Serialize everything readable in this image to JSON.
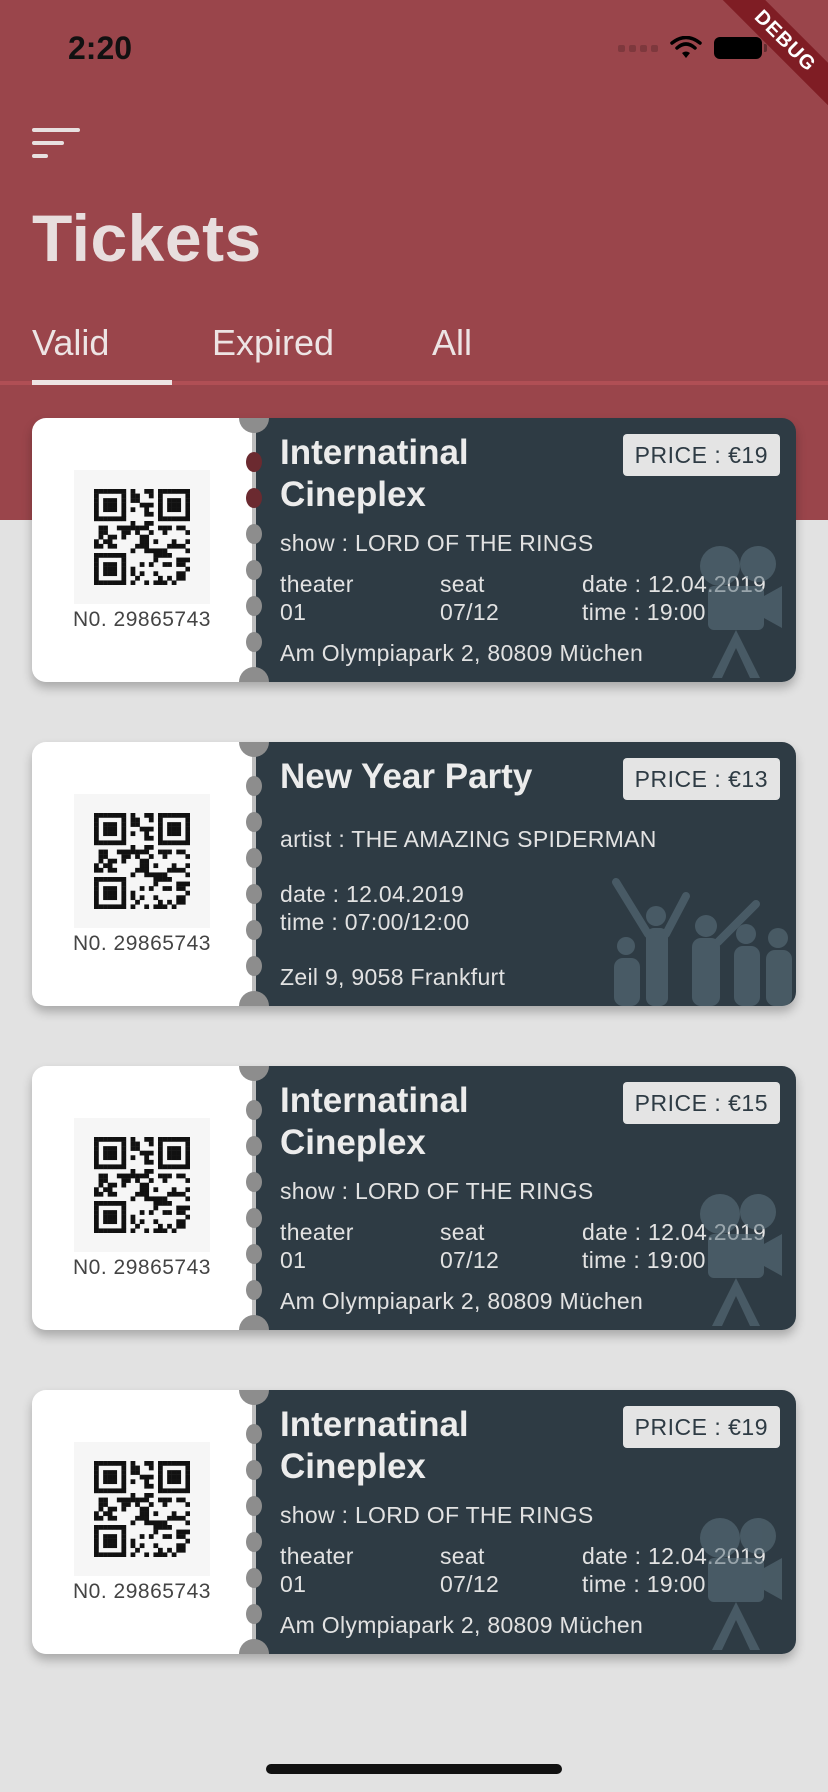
{
  "status_bar": {
    "time": "2:20"
  },
  "debug_label": "DEBUG",
  "header": {
    "title": "Tickets",
    "tabs": [
      {
        "label": "Valid",
        "active": true
      },
      {
        "label": "Expired",
        "active": false
      },
      {
        "label": "All",
        "active": false
      }
    ]
  },
  "colors": {
    "header_bg": "#9a454b",
    "ticket_body": "#2e3b44",
    "page_bg": "#e2e2e2"
  },
  "tickets": [
    {
      "number": "N0. 29865743",
      "title": "Internatinal Cineplex",
      "price": "PRICE : €19",
      "show": "show : LORD OF THE RINGS",
      "theater_label": "theater",
      "theater_value": "01",
      "seat_label": "seat",
      "seat_value": "07/12",
      "date": "date : 12.04.2019",
      "time": "time : 19:00",
      "address": "Am Olympiapark 2, 80809 Müchen",
      "icon": "camera-icon"
    },
    {
      "number": "N0. 29865743",
      "title": "New Year Party",
      "price": "PRICE : €13",
      "artist": "artist : THE AMAZING SPIDERMAN",
      "date": "date : 12.04.2019",
      "time": "time : 07:00/12:00",
      "address": "Zeil 9, 9058 Frankfurt",
      "icon": "crowd-icon"
    },
    {
      "number": "N0. 29865743",
      "title": "Internatinal Cineplex",
      "price": "PRICE : €15",
      "show": "show : LORD OF THE RINGS",
      "theater_label": "theater",
      "theater_value": "01",
      "seat_label": "seat",
      "seat_value": "07/12",
      "date": "date : 12.04.2019",
      "time": "time : 19:00",
      "address": "Am Olympiapark 2, 80809 Müchen",
      "icon": "camera-icon"
    },
    {
      "number": "N0. 29865743",
      "title": "Internatinal Cineplex",
      "price": "PRICE : €19",
      "show": "show : LORD OF THE RINGS",
      "theater_label": "theater",
      "theater_value": "01",
      "seat_label": "seat",
      "seat_value": "07/12",
      "date": "date : 12.04.2019",
      "time": "time : 19:00",
      "address": "Am Olympiapark 2, 80809 Müchen",
      "icon": "camera-icon"
    }
  ]
}
